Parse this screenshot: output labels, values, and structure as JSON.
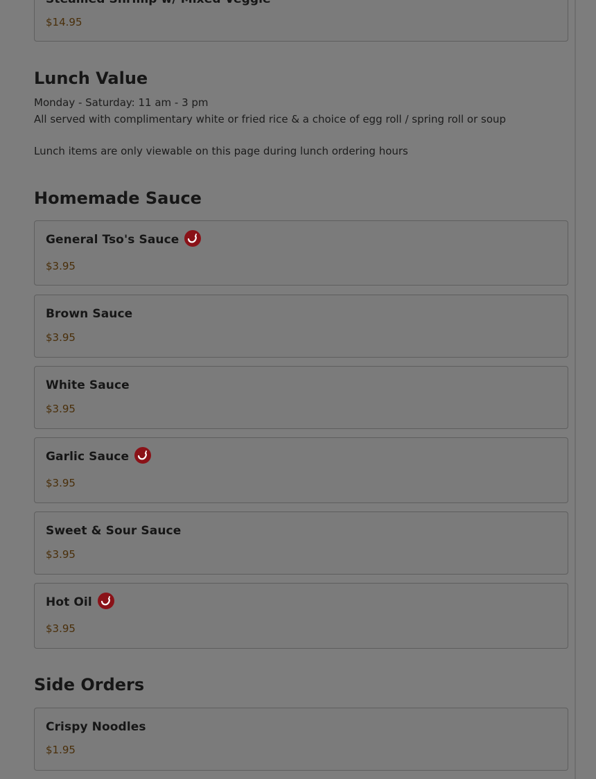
{
  "top_item": {
    "name": "Steamed Shrimp w/ Mixed Veggie",
    "price": "$14.95"
  },
  "lunch": {
    "title": "Lunch Value",
    "hours": "Monday - Saturday: 11 am - 3 pm",
    "details": "All served with complimentary white or fried rice & a choice of egg roll / spring roll or soup",
    "note": "Lunch items are only viewable on this page during lunch ordering hours"
  },
  "sauce": {
    "title": "Homemade Sauce",
    "items": [
      {
        "name": "General Tso's Sauce",
        "price": "$3.95",
        "spicy": true
      },
      {
        "name": "Brown Sauce",
        "price": "$3.95",
        "spicy": false
      },
      {
        "name": "White Sauce",
        "price": "$3.95",
        "spicy": false
      },
      {
        "name": "Garlic Sauce",
        "price": "$3.95",
        "spicy": true
      },
      {
        "name": "Sweet & Sour Sauce",
        "price": "$3.95",
        "spicy": false
      },
      {
        "name": "Hot Oil",
        "price": "$3.95",
        "spicy": true
      }
    ]
  },
  "sides": {
    "title": "Side Orders",
    "items": [
      {
        "name": "Crispy Noodles",
        "price": "$1.95"
      }
    ]
  },
  "icons": {
    "spicy": "chili-pepper-icon"
  },
  "colors": {
    "overlay_background": "#7d7d7d",
    "price": "#4a2f0a",
    "spicy_badge": "#8a1218"
  }
}
